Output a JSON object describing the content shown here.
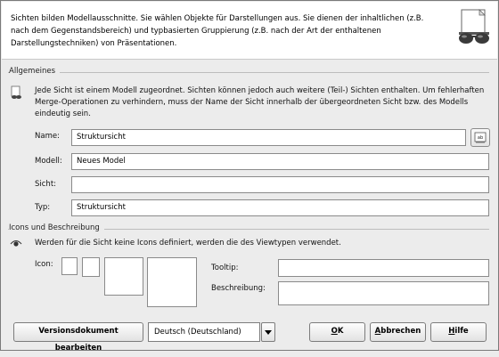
{
  "header": {
    "description": "Sichten bilden Modellausschnitte. Sie wählen Objekte für Darstellungen aus. Sie dienen der inhaltlichen (z.B. nach dem Gegenstandsbereich) und typbasierten Gruppierung (z.B. nach der Art der enthaltenen Darstellungstechniken) von Präsentationen.",
    "icon": "glasses-icon"
  },
  "general": {
    "section_title": "Allgemeines",
    "info_icon": "document-info-icon",
    "info_text": "Jede Sicht ist einem Modell zugeordnet. Sichten können jedoch auch weitere (Teil-) Sichten enthalten. Um fehlerhaften Merge-Operationen zu verhindern, muss der Name der Sicht innerhalb der übergeordneten Sicht bzw. des Modells eindeutig sein.",
    "name_label": "Name:",
    "name_value": "Struktursicht",
    "rename_button_icon": "text-edit-icon",
    "model_label": "Modell:",
    "model_value": "Neues Model",
    "view_label": "Sicht:",
    "view_value": "",
    "type_label": "Typ:",
    "type_value": "Struktursicht"
  },
  "icons": {
    "section_title": "Icons und Beschreibung",
    "info_icon": "eye-icon",
    "info_text": "Werden für die Sicht keine Icons definiert, werden die des Viewtypen verwendet.",
    "icon_label": "Icon:",
    "tooltip_label": "Tooltip:",
    "tooltip_value": "",
    "description_label": "Beschreibung:",
    "description_value": ""
  },
  "footer": {
    "version_button": "Versionsdokument bearbeiten",
    "language_selected": "Deutsch (Deutschland)",
    "ok_mnemonic": "O",
    "ok_rest": "K",
    "cancel_mnemonic": "A",
    "cancel_rest": "bbrechen",
    "help_mnemonic": "H",
    "help_rest": "ilfe"
  }
}
